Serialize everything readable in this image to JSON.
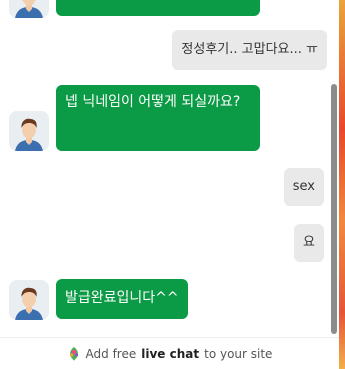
{
  "messages": [
    {
      "from": "operator",
      "text": ""
    },
    {
      "from": "visitor",
      "text": "정성후기.. 고맙다요... ㅠ"
    },
    {
      "from": "operator",
      "text": "넵 닉네임이 어떻게 되실까요?"
    },
    {
      "from": "visitor",
      "text": "sex"
    },
    {
      "from": "visitor",
      "text": "요"
    },
    {
      "from": "operator",
      "text": "발급완료입니다^^"
    }
  ],
  "footer": {
    "prefix": "Add free",
    "emphasis": "live chat",
    "suffix": "to your site",
    "icon": "livechat-logo-icon"
  },
  "colors": {
    "operator_bubble": "#0b9a45",
    "visitor_bubble": "#e9e9e9",
    "scrollbar": "#8b8b8b"
  }
}
